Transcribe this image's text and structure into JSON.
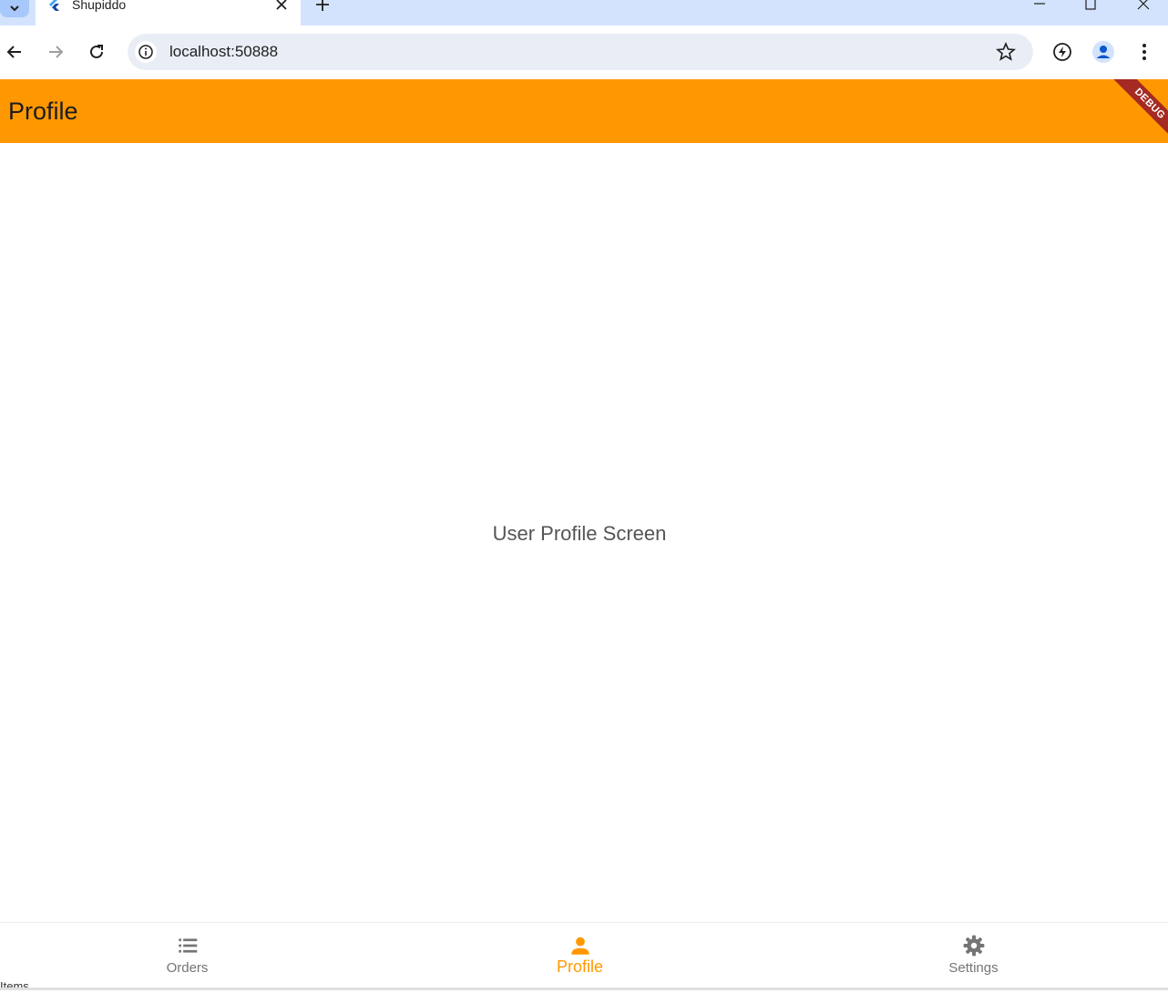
{
  "browser": {
    "tab_title": "Shupiddo",
    "url": "localhost:50888"
  },
  "app": {
    "title": "Profile",
    "debug_label": "DEBUG",
    "body_text": "User Profile Screen",
    "accent_color": "#ff9800"
  },
  "bottom_nav": {
    "items": [
      {
        "label": "Orders",
        "icon": "list-icon",
        "active": false
      },
      {
        "label": "Profile",
        "icon": "person-icon",
        "active": true
      },
      {
        "label": "Settings",
        "icon": "gear-icon",
        "active": false
      }
    ]
  },
  "stray": {
    "text": "Items"
  }
}
